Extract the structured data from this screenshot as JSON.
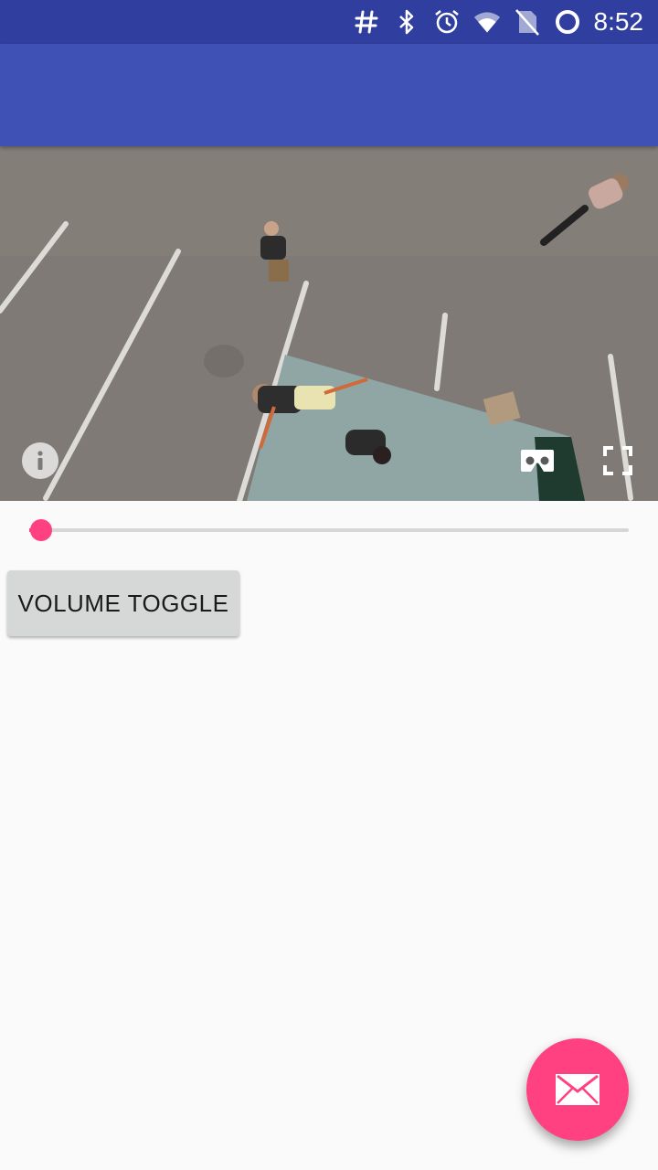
{
  "status_bar": {
    "time": "8:52",
    "icons": [
      "hash-icon",
      "bluetooth-icon",
      "alarm-icon",
      "wifi-icon",
      "no-sim-icon",
      "sync-icon"
    ]
  },
  "colors": {
    "status_bar": "#303f9f",
    "app_bar": "#3f51b5",
    "accent": "#ff4081",
    "background": "#fafafa"
  },
  "video": {
    "controls": [
      "info-icon",
      "cardboard-icon",
      "fullscreen-icon"
    ],
    "progress": 0.02
  },
  "buttons": {
    "volume_toggle": "VOLUME TOGGLE"
  },
  "fab": {
    "icon": "mail-icon"
  }
}
